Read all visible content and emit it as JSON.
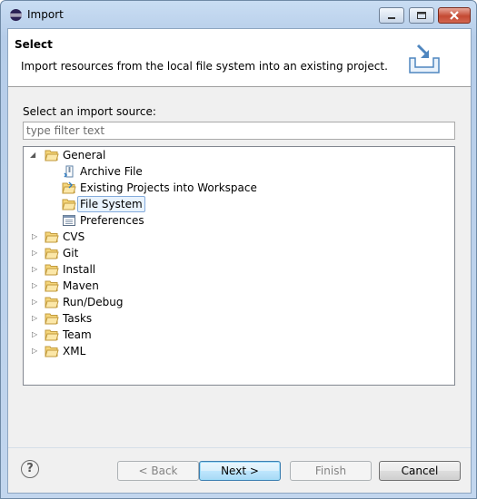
{
  "window": {
    "title": "Import"
  },
  "header": {
    "title": "Select",
    "description": "Import resources from the local file system into an existing project."
  },
  "source": {
    "label": "Select an import source:",
    "filter_placeholder": "type filter text",
    "filter_value": ""
  },
  "tree": {
    "general": "General",
    "general_children": [
      "Archive File",
      "Existing Projects into Workspace",
      "File System",
      "Preferences"
    ],
    "selected": "File System",
    "others": [
      "CVS",
      "Git",
      "Install",
      "Maven",
      "Run/Debug",
      "Tasks",
      "Team",
      "XML"
    ]
  },
  "buttons": {
    "back": "< Back",
    "next": "Next >",
    "finish": "Finish",
    "cancel": "Cancel"
  },
  "icons": {
    "app": "eclipse-icon",
    "banner": "import-wizard-icon",
    "folder": "folder-icon",
    "help": "help-icon"
  }
}
